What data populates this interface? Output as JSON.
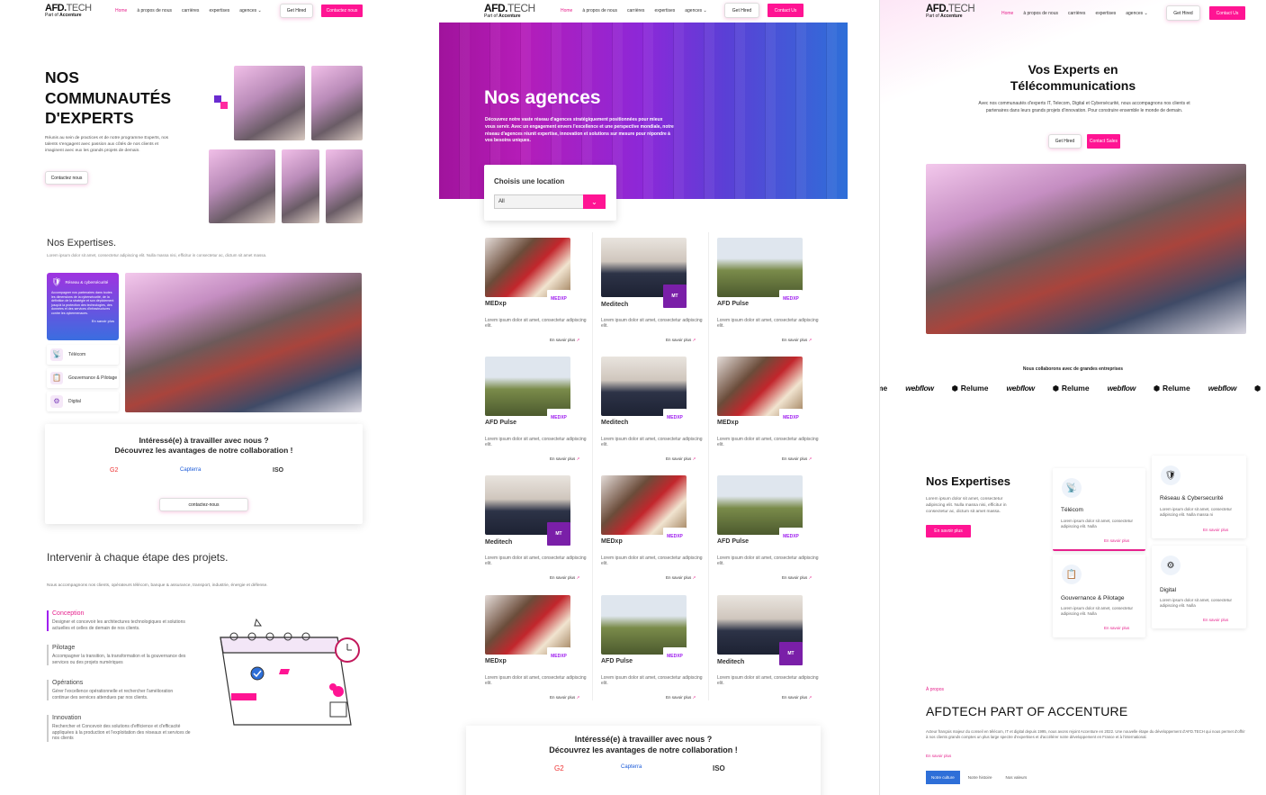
{
  "brand": {
    "logo_main": "AFD",
    "logo_dot": ".",
    "logo_tech": "TECH",
    "part_of": "Part of",
    "accenture": "Accenture"
  },
  "colors": {
    "accent": "#ff1493",
    "purple": "#7a1fa8",
    "blue": "#2e6fd8"
  },
  "nav": {
    "home": "Home",
    "about": "à propos de nous",
    "careers": "carrières",
    "expertise": "expertises",
    "agencies": "agences",
    "get_hired": "Get Hired",
    "contact_p1": "Contactez nous",
    "contact_en": "Contact Us"
  },
  "p1": {
    "hero_title_1": "NOS",
    "hero_title_2": "COMMUNAUTÉS",
    "hero_title_3": "D'EXPERTS",
    "hero_text": "Réunis au sein de practices et de notre programme Experts, nos talents s'engagent avec passion aux côtés de nos clients et imaginent avec eux les grands projets de demain.",
    "hero_button": "Contactez nous",
    "exp_title": "Nos Expertises.",
    "exp_sub": "Lorem ipsum dolor sit amet, consectetur adipiscing elit. Nulla massa nisi, efficitur in consectetur ac, dictum sit amet massa.",
    "exp_active_title": "Réseau & cybersécurité",
    "exp_active_text": "Accompagner nos partenaires dans toutes les dimensions de la cybersécurité, de la définition de la stratégie et son déploiement jusqu'à la protection des technologies, des données et des services d'infrastructures contre les cybermenaces.",
    "exp_active_more": "En savoir plus",
    "exp_items": [
      "Télécom",
      "Gouvernance & Pilotage",
      "Digital"
    ],
    "cta_title_1": "Intéressé(e) à travailler avec nous ?",
    "cta_title_2": "Découvrez les avantages de notre collaboration !",
    "cta_button": "contactez-nous",
    "trust": [
      "G2",
      "Capterra",
      "ISO"
    ],
    "steps_title": "Intervenir à chaque étape des projets.",
    "steps_sub": "Nous accompagnons nos clients, opérateurs télécom, banque & assurance, transport, industrie, énergie et défense.",
    "steps": [
      {
        "title": "Conception",
        "text": "Designer et concevoir les architectures technologiques et solutions actuelles et celles de demain de nos clients."
      },
      {
        "title": "Pilotage",
        "text": "Accompagner la transition, la transformation et la gouvernance des services ou des projets numériques"
      },
      {
        "title": "Opérations",
        "text": "Gérer l'excellence opérationnelle et rechercher l'amélioration continue des services attendues par nos clients."
      },
      {
        "title": "Innovation",
        "text": "Rechercher et Concevoir des solutions d'efficience et d'efficacité appliquées à la production et l'exploitation des réseaux et services de nos clients"
      }
    ]
  },
  "p2": {
    "hero_title": "Nos agences",
    "hero_text": "Découvrez notre vaste réseau d'agences stratégiquement positionnées pour mieux vous servir. Avec un engagement envers l'excellence et une perspective mondiale, notre réseau d'agences réunit expertise, innovation et solutions sur mesure pour répondre à vos besoins uniques.",
    "location_label": "Choisis une location",
    "location_value": "All",
    "card_text": "Lorem ipsum dolor sit amet, consectetur adipiscing elit.",
    "card_more": "En savoir plus",
    "agencies": [
      {
        "name": "MEDxp",
        "img": "two",
        "badge": "MEDXP"
      },
      {
        "name": "Meditech",
        "img": "group",
        "badge": "MT"
      },
      {
        "name": "AFD Pulse",
        "img": "field",
        "badge": "MEDXP"
      },
      {
        "name": "AFD Pulse",
        "img": "field",
        "badge": "MEDXP"
      },
      {
        "name": "Meditech",
        "img": "group",
        "badge": "MEDXP"
      },
      {
        "name": "MEDxp",
        "img": "two",
        "badge": "MEDXP"
      },
      {
        "name": "Meditech",
        "img": "group",
        "badge": "MT"
      },
      {
        "name": "MEDxp",
        "img": "two",
        "badge": "MEDXP"
      },
      {
        "name": "AFD Pulse",
        "img": "field",
        "badge": "MEDXP"
      },
      {
        "name": "MEDxp",
        "img": "two",
        "badge": "MEDXP"
      },
      {
        "name": "AFD Pulse",
        "img": "field",
        "badge": "MEDXP"
      },
      {
        "name": "Meditech",
        "img": "group",
        "badge": "MT"
      }
    ],
    "cta_title_1": "Intéressé(e) à travailler avec nous ?",
    "cta_title_2": "Découvrez les avantages de notre collaboration !"
  },
  "p3": {
    "hero_title_1": "Vos Experts en",
    "hero_title_2": "Télécommunications",
    "hero_text": "Avec nos communautés d'experts IT, Telecom, Digital et Cybersécurité, nous accompagnons nos clients et partenaires dans leurs grands projets d'innovation. Pour construire ensemble le monde de demain.",
    "get_hired": "Get Hired",
    "contact_sales": "Contact Sales",
    "partners_title": "Nous collaborons avec de grandes entreprises",
    "partners": [
      "me",
      "webflow",
      "Relume",
      "webflow",
      "Relume",
      "webflow",
      "Relume",
      "webflow",
      ""
    ],
    "exp_title": "Nos Expertises",
    "exp_text": "Lorem ipsum dolor sit amet, consectetur adipiscing elit. Nulla massa nisi, efficitur in consectetur ac, dictum sit amet massa.",
    "exp_button": "En savoir plus",
    "exp_cards": [
      {
        "title": "Télécom",
        "text": "Lorem ipsum dolor sit amet, consectetur adipiscing elit. Nulla",
        "more": "En savoir plus"
      },
      {
        "title": "Réseau & Cybersecurité",
        "text": "Lorem ipsum dolor sit amet, consectetur adipiscing elit. Nulla massa ni",
        "more": "En savoir plus"
      },
      {
        "title": "Gouvernance & Pilotage",
        "text": "Lorem ipsum dolor sit amet, consectetur adipiscing elit. Nulla",
        "more": "En savoir plus"
      },
      {
        "title": "Digital",
        "text": "Lorem ipsum dolor sit amet, consectetur adipiscing elit. Nulla",
        "more": "En savoir plus"
      }
    ],
    "about_kicker": "À propos",
    "about_title": "AFDTECH PART OF ACCENTURE",
    "about_text": "Acteur français majeur du conseil en télécom, IT et digital depuis 1995, nous avons rejoint Accenture en 2022. Une nouvelle étape du développement d'AFD.TECH qui nous permet d'offrir à nos clients grands comptes un plus large spectre d'expertises et d'accélérer notre développement en France et à l'international.",
    "about_more": "En savoir plus",
    "tabs": [
      "Notre culture",
      "Notre histoire",
      "Nos valeurs"
    ]
  }
}
